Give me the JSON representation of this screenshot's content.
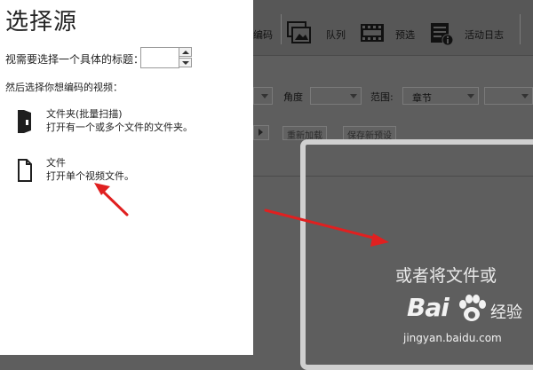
{
  "left_pane": {
    "title": "选择源",
    "title_prompt": "视需要选择一个具体的标题：",
    "choose_prompt": "然后选择你想编码的视频：",
    "options": [
      {
        "name": "文件夹(批量扫描)",
        "description": "打开有一个或多个文件的文件夹。"
      },
      {
        "name": "文件",
        "description": "打开单个视频文件。"
      }
    ]
  },
  "toolbar": {
    "items": [
      {
        "label": "编码"
      },
      {
        "label": "队列"
      },
      {
        "label": "预选"
      },
      {
        "label": "活动日志"
      }
    ]
  },
  "settings": {
    "angle_label": "角度",
    "range_label": "范围:",
    "range_value": "章节"
  },
  "buttons": {
    "reload": "重新加载",
    "save_preset": "保存新预设"
  },
  "drop_zone": {
    "hint": "或者将文件或"
  },
  "watermark": {
    "brand": "Bai",
    "brand_cn": "经验",
    "url": "jingyan.baidu.com"
  },
  "colors": {
    "overlay": "#5e5e5e",
    "annotation_arrow": "#e02020",
    "drop_border": "#d0d0d0"
  }
}
